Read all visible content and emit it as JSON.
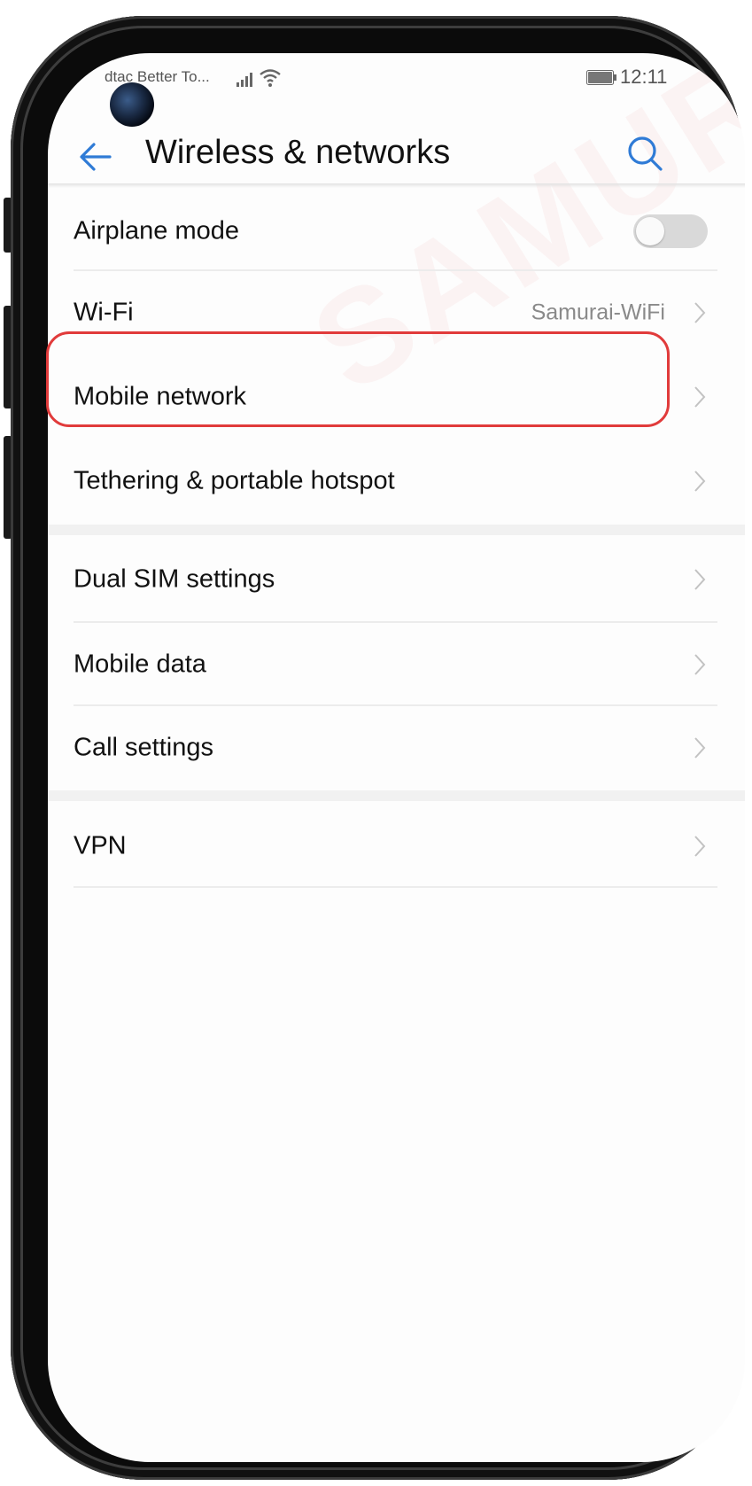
{
  "status_bar": {
    "carrier": "dtac Better To...",
    "time": "12:11",
    "icons": [
      "signal-icon",
      "wifi-icon",
      "battery-icon"
    ]
  },
  "app_bar": {
    "title": "Wireless & networks",
    "back_icon": "back-arrow-icon",
    "search_icon": "search-icon",
    "accent_color": "#2f7bd6"
  },
  "watermark": {
    "text": "SAMURAI"
  },
  "settings": {
    "airplane_mode": {
      "label": "Airplane mode",
      "toggle_on": false
    },
    "wifi": {
      "label": "Wi-Fi",
      "value": "Samurai-WiFi"
    },
    "mobile_network": {
      "label": "Mobile network",
      "highlighted": true,
      "highlight_color": "#e13b3b"
    },
    "tethering": {
      "label": "Tethering & portable hotspot"
    },
    "dual_sim": {
      "label": "Dual SIM settings"
    },
    "mobile_data": {
      "label": "Mobile data"
    },
    "call_settings": {
      "label": "Call settings"
    },
    "vpn": {
      "label": "VPN"
    }
  }
}
